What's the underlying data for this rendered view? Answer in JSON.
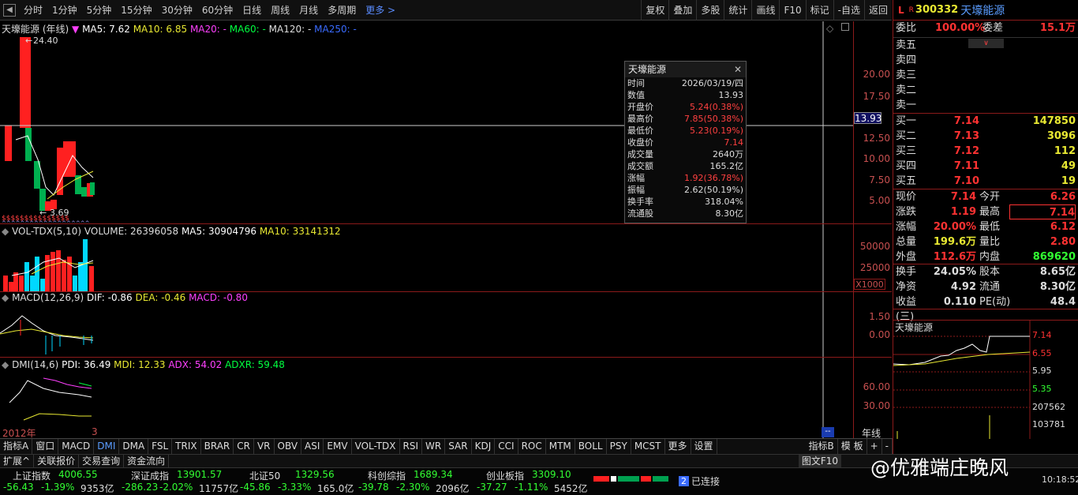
{
  "nav": {
    "items": [
      "分时",
      "1分钟",
      "5分钟",
      "15分钟",
      "30分钟",
      "60分钟",
      "日线",
      "周线",
      "月线",
      "多周期"
    ],
    "more": "更多 >",
    "right": [
      "复权",
      "叠加",
      "多股",
      "统计",
      "画线",
      "F10",
      "标记",
      "-自选",
      "返回"
    ]
  },
  "kline": {
    "stock_label": "天壕能源 (年线)",
    "ma5": "MA5: 7.62",
    "ma10": "MA10: 6.85",
    "ma20": "MA20: -",
    "ma60": "MA60: -",
    "ma120": "MA120: -",
    "ma250": "MA250: -",
    "high_label": "24.40",
    "low_label": "3.69",
    "ticks": [
      "20.00",
      "17.50",
      "13.93",
      "12.50",
      "10.00",
      "7.50",
      "5.00"
    ],
    "cursor_value": "13.93"
  },
  "vol": {
    "label": "VOL-TDX(5,10)",
    "volume": "VOLUME: 26396058",
    "ma5": "MA5: 30904796",
    "ma10": "MA10: 33141312",
    "ticks": [
      "50000",
      "25000"
    ],
    "unit": "X1000"
  },
  "macd": {
    "label": "MACD(12,26,9)",
    "dif": "DIF: -0.86",
    "dea": "DEA: -0.46",
    "macd": "MACD: -0.80",
    "ticks": [
      "1.50",
      "0.00"
    ]
  },
  "dmi": {
    "label": "DMI(14,6)",
    "pdi": "PDI: 36.49",
    "mdi": "MDI: 12.33",
    "adx": "ADX: 54.02",
    "adxr": "ADXR: 59.48",
    "ticks": [
      "60.00",
      "30.00"
    ]
  },
  "xaxis": {
    "year": "2012年",
    "three": "3",
    "unit": "年线"
  },
  "tooltip": {
    "title": "天壕能源",
    "rows": [
      {
        "k": "时间",
        "v": "2026/03/19/四",
        "red": false
      },
      {
        "k": "数值",
        "v": "13.93",
        "red": false
      },
      {
        "k": "开盘价",
        "v": "5.24(0.38%)",
        "red": true
      },
      {
        "k": "最高价",
        "v": "7.85(50.38%)",
        "red": true
      },
      {
        "k": "最低价",
        "v": "5.23(0.19%)",
        "red": true
      },
      {
        "k": "收盘价",
        "v": "7.14",
        "red": true
      },
      {
        "k": "成交量",
        "v": "2640万",
        "red": false
      },
      {
        "k": "成交额",
        "v": "165.2亿",
        "red": false
      },
      {
        "k": "涨幅",
        "v": "1.92(36.78%)",
        "red": true
      },
      {
        "k": "振幅",
        "v": "2.62(50.19%)",
        "red": false
      },
      {
        "k": "换手率",
        "v": "318.04%",
        "red": false
      },
      {
        "k": "流通股",
        "v": "8.30亿",
        "red": false
      }
    ]
  },
  "quote": {
    "flag_l": "L",
    "flag_r": "R",
    "code": "300332",
    "name": "天壕能源",
    "weibi_label": "委比",
    "weibi": "100.00%",
    "weicha_label": "委差",
    "weicha": "15.1万",
    "sells": [
      "卖五",
      "卖四",
      "卖三",
      "卖二",
      "卖一"
    ],
    "buys": [
      {
        "label": "买一",
        "price": "7.14",
        "vol": "147850"
      },
      {
        "label": "买二",
        "price": "7.13",
        "vol": "3096"
      },
      {
        "label": "买三",
        "price": "7.12",
        "vol": "112"
      },
      {
        "label": "买四",
        "price": "7.11",
        "vol": "49"
      },
      {
        "label": "买五",
        "price": "7.10",
        "vol": "19"
      }
    ],
    "stats": [
      {
        "k": "现价",
        "v": "7.14",
        "vc": "red",
        "k2": "今开",
        "v2": "6.26",
        "v2c": "red"
      },
      {
        "k": "涨跌",
        "v": "1.19",
        "vc": "red",
        "k2": "最高",
        "v2": "7.14",
        "v2c": "red"
      },
      {
        "k": "涨幅",
        "v": "20.00%",
        "vc": "red",
        "k2": "最低",
        "v2": "6.12",
        "v2c": "red"
      },
      {
        "k": "总量",
        "v": "199.6万",
        "vc": "yel",
        "k2": "量比",
        "v2": "2.80",
        "v2c": "red"
      },
      {
        "k": "外盘",
        "v": "112.6万",
        "vc": "red",
        "k2": "内盘",
        "v2": "869620",
        "v2c": "grn"
      },
      {
        "k": "换手",
        "v": "24.05%",
        "vc": "wht",
        "k2": "股本",
        "v2": "8.65亿",
        "v2c": "wht"
      },
      {
        "k": "净资",
        "v": "4.92",
        "vc": "wht",
        "k2": "流通",
        "v2": "8.30亿",
        "v2c": "wht"
      },
      {
        "k": "收益(三)",
        "v": "0.110",
        "vc": "wht",
        "k2": "PE(动)",
        "v2": "48.4",
        "v2c": "wht"
      }
    ],
    "mini_title": "天壕能源",
    "mini_ticks": [
      "7.14",
      "6.55",
      "5.95",
      "5.35"
    ],
    "mini_vol_ticks": [
      "207562",
      "103781"
    ]
  },
  "bottom_tabs": [
    "指标A",
    "窗口",
    "MACD",
    "DMI",
    "DMA",
    "FSL",
    "TRIX",
    "BRAR",
    "CR",
    "VR",
    "OBV",
    "ASI",
    "EMV",
    "VOL-TDX",
    "RSI",
    "WR",
    "SAR",
    "KDJ",
    "CCI",
    "ROC",
    "MTM",
    "BOLL",
    "PSY",
    "MCST",
    "更多",
    "设置"
  ],
  "bottom_tabs_right": [
    "指标B",
    "模 板",
    "+",
    "-"
  ],
  "bottom2": [
    "扩展^",
    "关联报价",
    "交易查询",
    "资金流向"
  ],
  "bottom2_right": "图文F10",
  "indices": [
    {
      "name": "上证指数",
      "val": "4006.55",
      "chg": "-56.43",
      "pct": "-1.39%",
      "amt": "9353亿"
    },
    {
      "name": "深证成指",
      "val": "13901.57",
      "chg": "-286.23",
      "pct": "-2.02%",
      "amt": "11757亿"
    },
    {
      "name": "北证50",
      "val": "1329.56",
      "chg": "-45.86",
      "pct": "-3.33%",
      "amt": "165.0亿"
    },
    {
      "name": "科创综指",
      "val": "1689.34",
      "chg": "-39.78",
      "pct": "-2.30%",
      "amt": "2096亿"
    },
    {
      "name": "创业板指",
      "val": "3309.10",
      "chg": "-37.27",
      "pct": "-1.11%",
      "amt": "5452亿"
    }
  ],
  "status": {
    "conn_num": "2",
    "conn": "已连接",
    "time": "10:18:52"
  },
  "watermark": "@优雅端庄晚风",
  "colors": {
    "up": "#ff3232",
    "down": "#00a050",
    "accent": "#5a9cff",
    "grid": "#8b1a1a"
  }
}
